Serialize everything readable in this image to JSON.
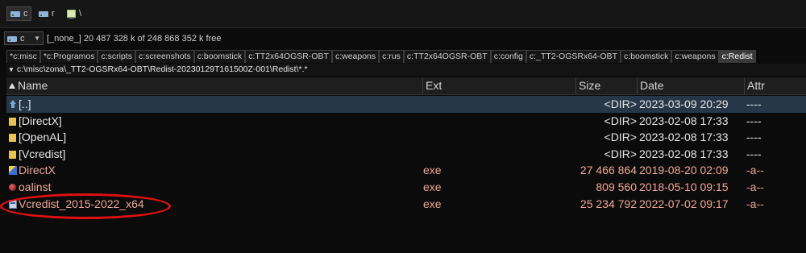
{
  "top_drives": [
    {
      "label": "c",
      "icon": "drive-icon"
    },
    {
      "label": "r",
      "icon": "drive-icon"
    },
    {
      "label": "\\",
      "icon": "network-drive-icon"
    }
  ],
  "drive_bar": {
    "selected_drive": "c",
    "info": "[_none_]  20 487 328 k of 248 868 352 k free"
  },
  "tabs": [
    "*c:misc",
    "*c:Programos",
    "c:scripts",
    "c:screenshots",
    "c:boomstick",
    "c:TT2x64OGSR-OBT",
    "c:weapons",
    "c:rus",
    "c:TT2x64OGSR-OBT",
    "c:config",
    "c:_TT2-OGSRx64-OBT",
    "c:boomstick",
    "c:weapons",
    "c:Redist"
  ],
  "path": "c:\\misc\\zona\\_TT2-OGSRx64-OBT\\Redist-20230129T161500Z-001\\Redist\\*.*",
  "columns": {
    "name": "Name",
    "ext": "Ext",
    "size": "Size",
    "date": "Date",
    "attr": "Attr"
  },
  "rows": [
    {
      "name": "[..]",
      "ext": "",
      "size": "<DIR>",
      "date": "2023-03-09 20:29",
      "attr": "----",
      "icon": "up-arrow-icon"
    },
    {
      "name": "[DirectX]",
      "ext": "",
      "size": "<DIR>",
      "date": "2023-02-08 17:33",
      "attr": "----",
      "icon": "folder-icon"
    },
    {
      "name": "[OpenAL]",
      "ext": "",
      "size": "<DIR>",
      "date": "2023-02-08 17:33",
      "attr": "----",
      "icon": "folder-icon"
    },
    {
      "name": "[Vcredist]",
      "ext": "",
      "size": "<DIR>",
      "date": "2023-02-08 17:33",
      "attr": "----",
      "icon": "folder-icon"
    },
    {
      "name": "DirectX",
      "ext": "exe",
      "size": "27 466 864",
      "date": "2019-08-20 02:09",
      "attr": "-a--",
      "icon": "directx-app-icon"
    },
    {
      "name": "oalinst",
      "ext": "exe",
      "size": "809 560",
      "date": "2018-05-10 09:15",
      "attr": "-a--",
      "icon": "openal-app-icon"
    },
    {
      "name": "Vcredist_2015-2022_x64",
      "ext": "exe",
      "size": "25 234 792",
      "date": "2022-07-02 09:17",
      "attr": "-a--",
      "icon": "installer-app-icon"
    }
  ],
  "colors": {
    "background": "#0b0b0b",
    "selected_row": "#253749",
    "file_text": "#f0a898",
    "highlight_ring": "#e01010"
  }
}
